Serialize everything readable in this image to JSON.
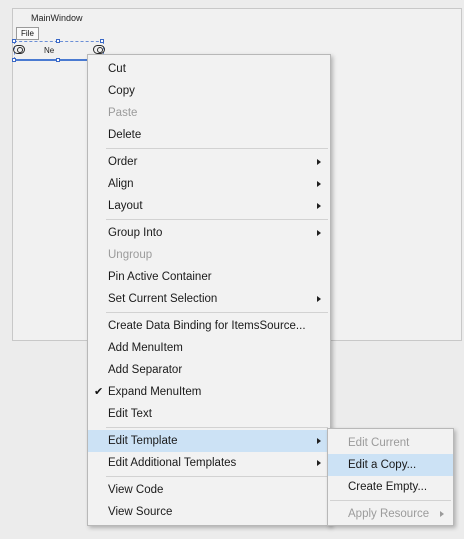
{
  "designer": {
    "window_title": "MainWindow",
    "file_menu_label": "File",
    "selected_item_text": "Ne"
  },
  "context_menu": {
    "groups": [
      [
        {
          "label": "Cut",
          "enabled": true
        },
        {
          "label": "Copy",
          "enabled": true
        },
        {
          "label": "Paste",
          "enabled": false
        },
        {
          "label": "Delete",
          "enabled": true
        }
      ],
      [
        {
          "label": "Order",
          "enabled": true,
          "submenu": true
        },
        {
          "label": "Align",
          "enabled": true,
          "submenu": true
        },
        {
          "label": "Layout",
          "enabled": true,
          "submenu": true
        }
      ],
      [
        {
          "label": "Group Into",
          "enabled": true,
          "submenu": true
        },
        {
          "label": "Ungroup",
          "enabled": false
        },
        {
          "label": "Pin Active Container",
          "enabled": true
        },
        {
          "label": "Set Current Selection",
          "enabled": true,
          "submenu": true
        }
      ],
      [
        {
          "label": "Create Data Binding for ItemsSource...",
          "enabled": true
        },
        {
          "label": "Add MenuItem",
          "enabled": true
        },
        {
          "label": "Add Separator",
          "enabled": true
        },
        {
          "label": "Expand MenuItem",
          "enabled": true,
          "checked": true
        },
        {
          "label": "Edit Text",
          "enabled": true
        }
      ],
      [
        {
          "label": "Edit Template",
          "enabled": true,
          "submenu": true,
          "highlighted": true
        },
        {
          "label": "Edit Additional Templates",
          "enabled": true,
          "submenu": true
        }
      ],
      [
        {
          "label": "View Code",
          "enabled": true
        },
        {
          "label": "View Source",
          "enabled": true
        }
      ]
    ]
  },
  "template_submenu": {
    "groups": [
      [
        {
          "label": "Edit Current",
          "enabled": false
        },
        {
          "label": "Edit a Copy...",
          "enabled": true,
          "highlighted": true
        },
        {
          "label": "Create Empty...",
          "enabled": true
        }
      ],
      [
        {
          "label": "Apply Resource",
          "enabled": false,
          "submenu": true
        }
      ]
    ]
  },
  "colors": {
    "highlight": "#cce2f5",
    "disabled_text": "#9b9b9b",
    "selection_accent": "#4a7ad1"
  }
}
